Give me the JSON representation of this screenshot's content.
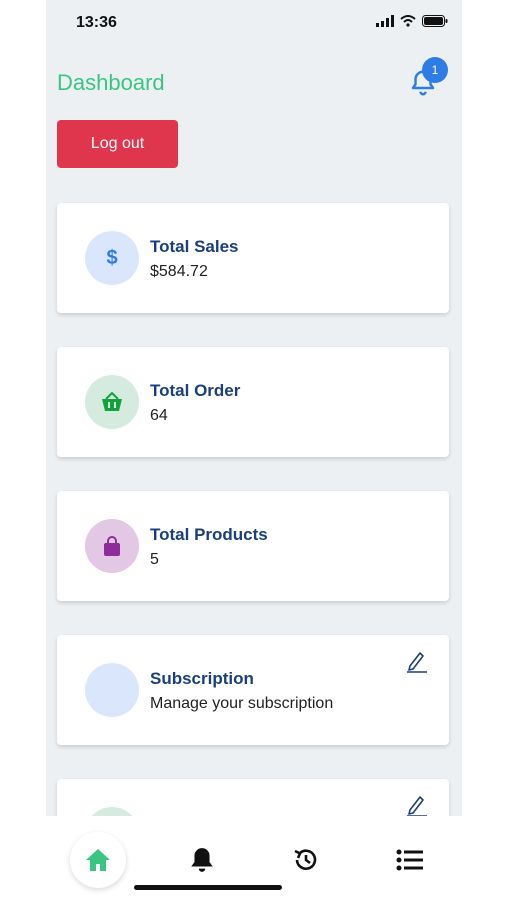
{
  "status_bar": {
    "time": "13:36"
  },
  "header": {
    "title": "Dashboard",
    "notification_count": "1"
  },
  "actions": {
    "logout_label": "Log out"
  },
  "cards": [
    {
      "title": "Total Sales",
      "value": "$584.72",
      "icon": "dollar-icon",
      "color": "#d9e6fb"
    },
    {
      "title": "Total Order",
      "value": "64",
      "icon": "basket-icon",
      "color": "#d6ebdf"
    },
    {
      "title": "Total Products",
      "value": "5",
      "icon": "bag-icon",
      "color": "#e3c8e6"
    },
    {
      "title": "Subscription",
      "value": "Manage your subscription",
      "icon": "blank-icon",
      "color": "#d9e6fb"
    }
  ],
  "bottom_nav": [
    "home-icon",
    "bell-icon",
    "history-icon",
    "list-icon"
  ],
  "colors": {
    "accent": "#3cc483",
    "danger": "#e0364d",
    "badge": "#2e7de6",
    "card_title": "#1c3f7a"
  }
}
